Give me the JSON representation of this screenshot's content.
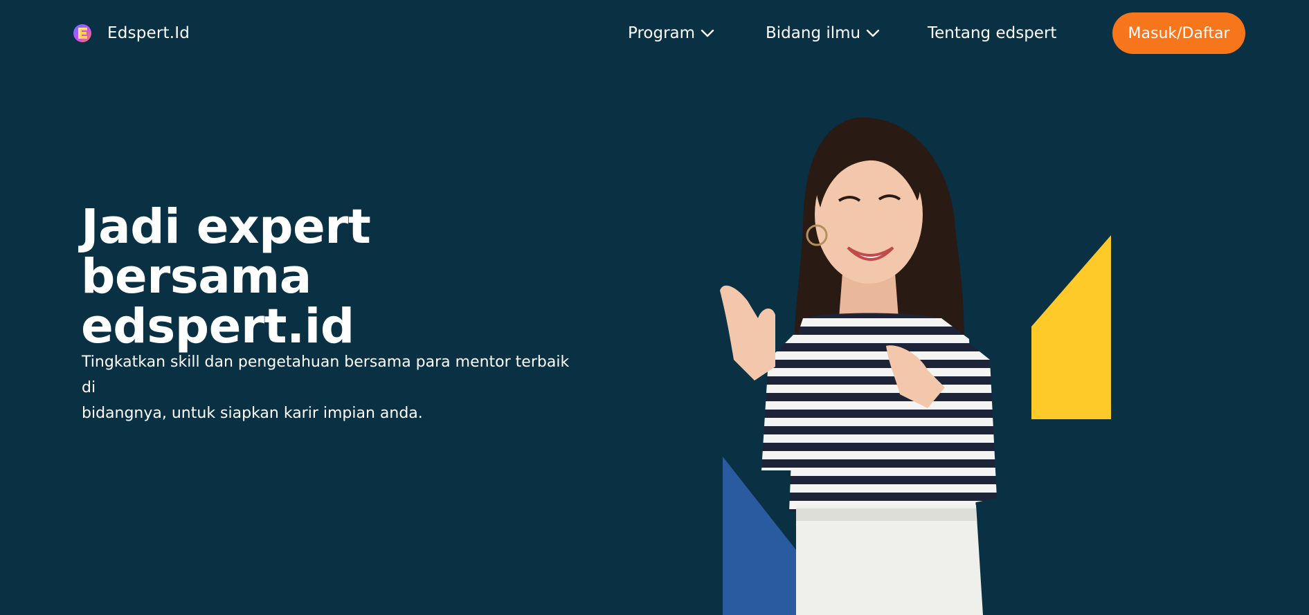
{
  "brand": {
    "name": "Edspert.Id",
    "logo_icon": "edspert-e-logo-icon"
  },
  "nav": {
    "items": [
      {
        "label": "Program",
        "icon": "chevron-down-icon"
      },
      {
        "label": "Bidang ilmu",
        "icon": "chevron-down-icon"
      },
      {
        "label": "Tentang edspert"
      }
    ],
    "cta_label": "Masuk/Daftar"
  },
  "hero": {
    "title_line1": "Jadi expert bersama",
    "title_line2": "edspert.id",
    "subtitle_line1": "Tingkatkan skill dan pengetahuan bersama para mentor terbaik di",
    "subtitle_line2": "bidangnya, untuk siapkan karir impian anda."
  },
  "colors": {
    "background": "#0a3044",
    "cta": "#f7761c",
    "accent_yellow": "#fdca2a",
    "accent_blue": "#2a5aa0"
  }
}
